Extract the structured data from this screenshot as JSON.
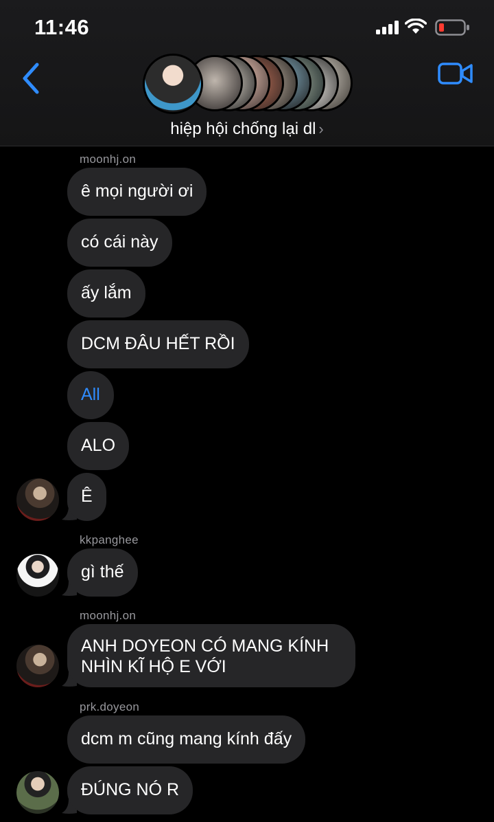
{
  "status_bar": {
    "time": "11:46"
  },
  "header": {
    "group_name": "hiệp hội chống lại dl",
    "chevron": "›"
  },
  "messages": [
    {
      "sender": "moonhj.on",
      "texts": [
        "ê mọi người ơi",
        "có cái này",
        "ấy lắm",
        "DCM ĐÂU HẾT RỒI",
        "All",
        "ALO",
        "Ê"
      ]
    },
    {
      "sender": "kkpanghee",
      "texts": [
        "gì thế"
      ]
    },
    {
      "sender": "moonhj.on",
      "texts": [
        "ANH DOYEON CÓ MANG KÍNH NHÌN KĨ HỘ E VỚI"
      ]
    },
    {
      "sender": "prk.doyeon",
      "texts": [
        "dcm m cũng mang kính đấy",
        "ĐÚNG NÓ R"
      ]
    }
  ],
  "colors": {
    "accent": "#2f8cff",
    "bubble": "#262628",
    "background": "#000000",
    "sender_text": "#98989d",
    "battery_low": "#ff3b30"
  },
  "icons": {
    "back": "chevron-left-icon",
    "video": "video-camera-icon",
    "signal": "signal-bars-icon",
    "wifi": "wifi-icon",
    "battery": "battery-icon"
  }
}
